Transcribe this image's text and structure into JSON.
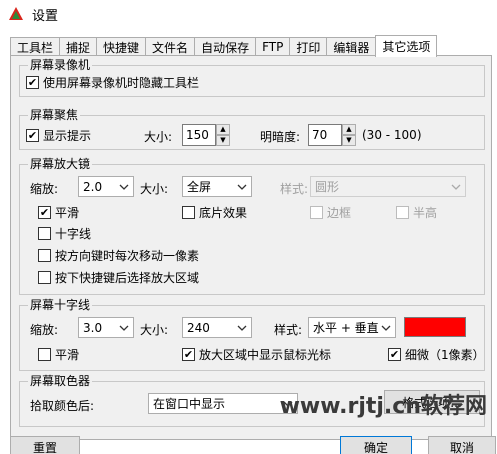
{
  "window": {
    "title": "设置"
  },
  "tabs": [
    {
      "label": "工具栏"
    },
    {
      "label": "捕捉"
    },
    {
      "label": "快捷键"
    },
    {
      "label": "文件名"
    },
    {
      "label": "自动保存"
    },
    {
      "label": "FTP"
    },
    {
      "label": "打印"
    },
    {
      "label": "编辑器"
    },
    {
      "label": "其它选项"
    }
  ],
  "recorder": {
    "title": "屏幕录像机",
    "hide_toolbar": {
      "label": "使用屏幕录像机时隐藏工具栏",
      "checked": true
    }
  },
  "focus": {
    "title": "屏幕聚焦",
    "show_hint": {
      "label": "显示提示",
      "checked": true
    },
    "size_label": "大小:",
    "size_value": "150",
    "brightness_label": "明暗度:",
    "brightness_value": "70",
    "range_text": "(30 - 100)"
  },
  "magnifier": {
    "title": "屏幕放大镜",
    "zoom_label": "缩放:",
    "zoom_value": "2.0",
    "size_label": "大小:",
    "size_value": "全屏",
    "style_label": "样式:",
    "style_value": "圆形",
    "smooth": {
      "label": "平滑",
      "checked": true
    },
    "negative": {
      "label": "底片效果",
      "checked": false
    },
    "border": {
      "label": "边框",
      "checked": false
    },
    "highlight": {
      "label": "半高",
      "checked": false
    },
    "crosshair": {
      "label": "十字线",
      "checked": false
    },
    "arrow_move": {
      "label": "按方向键时每次移动一像素",
      "checked": false
    },
    "select_region": {
      "label": "按下快捷键后选择放大区域",
      "checked": false
    }
  },
  "crosshair": {
    "title": "屏幕十字线",
    "zoom_label": "缩放:",
    "zoom_value": "3.0",
    "size_label": "大小:",
    "size_value": "240",
    "style_label": "样式:",
    "style_value": "水平 + 垂直",
    "color": "#ff0000",
    "smooth": {
      "label": "平滑",
      "checked": false
    },
    "show_cursor": {
      "label": "放大区域中显示鼠标光标",
      "checked": true
    },
    "thin": {
      "label": "细微（1像素）",
      "checked": true
    }
  },
  "picker": {
    "title": "屏幕取色器",
    "after_label": "拾取颜色后:",
    "after_value": "在窗口中显示",
    "format_button": "格式选项..."
  },
  "footer": {
    "reset_label": "重置",
    "ok_label": "确定",
    "cancel_label": "取消"
  },
  "watermark": {
    "text": "www.rjtj.cn软荐网"
  }
}
